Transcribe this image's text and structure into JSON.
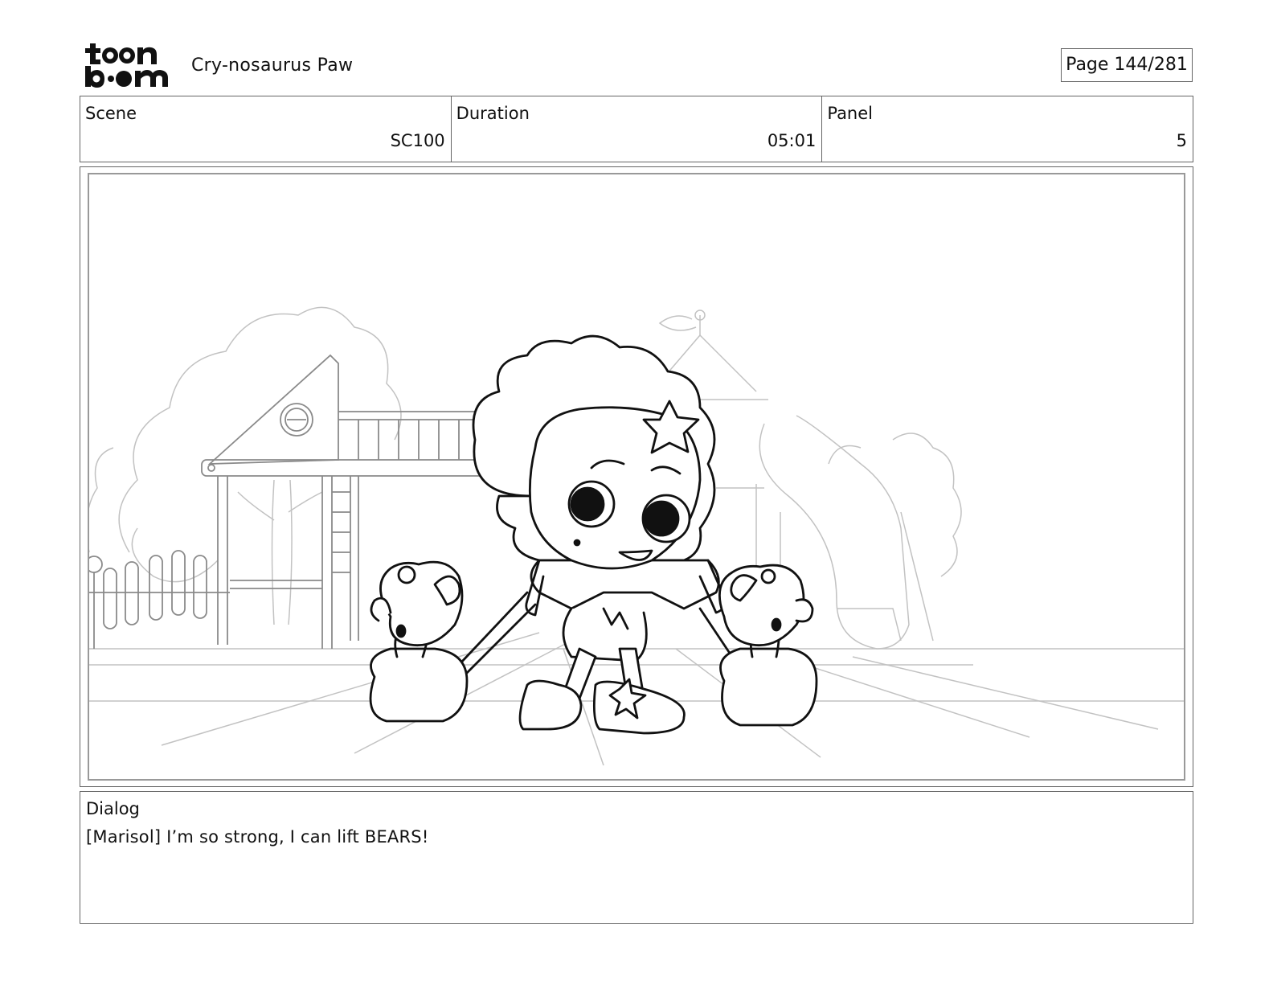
{
  "header": {
    "logo_text": "toonboom",
    "project_title": "Cry-nosaurus Paw",
    "page_indicator": "Page 144/281"
  },
  "info": {
    "scene_label": "Scene",
    "scene_value": "SC100",
    "duration_label": "Duration",
    "duration_value": "05:01",
    "panel_label": "Panel",
    "panel_value": "5"
  },
  "dialog": {
    "label": "Dialog",
    "text": "[Marisol] I’m so strong, I can lift BEARS!"
  },
  "colors": {
    "ink": "#111111",
    "border": "#666666",
    "sketch_light": "#b5b5b5"
  }
}
